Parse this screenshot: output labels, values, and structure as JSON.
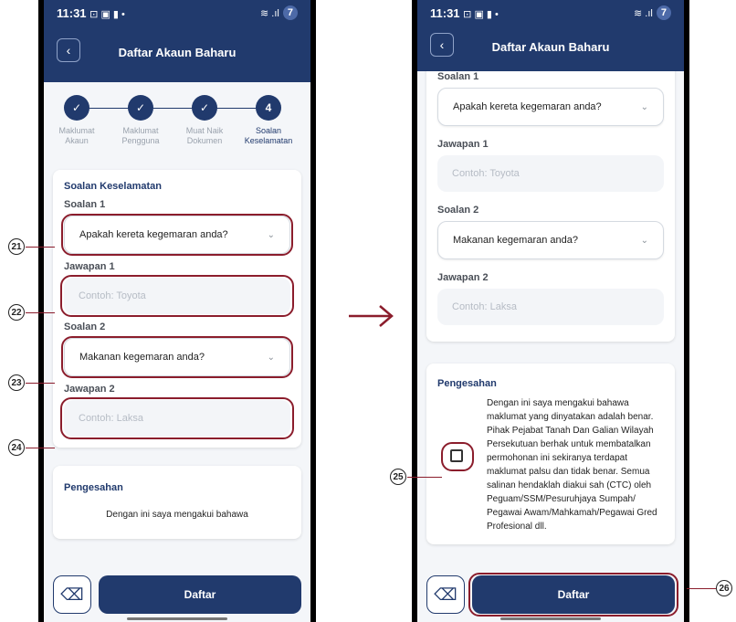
{
  "status": {
    "time": "11:31",
    "icons": "⊡ ▣ ▮ •",
    "signal": "≋ .ıl",
    "battery": "7"
  },
  "header": {
    "title": "Daftar Akaun Baharu",
    "back": "‹"
  },
  "steps": [
    {
      "num": "✓",
      "label1": "Maklumat",
      "label2": "Akaun"
    },
    {
      "num": "✓",
      "label1": "Maklumat",
      "label2": "Pengguna"
    },
    {
      "num": "✓",
      "label1": "Muat Naik",
      "label2": "Dokumen"
    },
    {
      "num": "4",
      "label1": "Soalan",
      "label2": "Keselamatan"
    }
  ],
  "security": {
    "title": "Soalan Keselamatan",
    "q1_label": "Soalan 1",
    "q1_value": "Apakah kereta kegemaran anda?",
    "a1_label": "Jawapan 1",
    "a1_placeholder": "Contoh: Toyota",
    "q2_label": "Soalan 2",
    "q2_value": "Makanan kegemaran anda?",
    "a2_label": "Jawapan 2",
    "a2_placeholder": "Contoh: Laksa"
  },
  "confirm": {
    "title": "Pengesahan",
    "preview": "Dengan ini saya mengakui bahawa",
    "text": "Dengan ini saya mengakui bahawa maklumat yang dinyatakan adalah benar. Pihak Pejabat Tanah Dan Galian Wilayah Persekutuan berhak untuk membatalkan permohonan ini sekiranya terdapat maklumat palsu dan tidak benar. Semua salinan hendaklah diakui sah (CTC) oleh Peguam/SSM/Pesuruhjaya Sumpah/ Pegawai Awam/Mahkamah/Pegawai Gred Profesional dll."
  },
  "footer": {
    "submit": "Daftar",
    "erase_icon": "eraser-icon"
  },
  "callouts": [
    "21",
    "22",
    "23",
    "24",
    "25",
    "26"
  ],
  "colors": {
    "primary": "#213a6d",
    "highlight": "#8b1d2c",
    "arrow": "#8b1d2c"
  }
}
